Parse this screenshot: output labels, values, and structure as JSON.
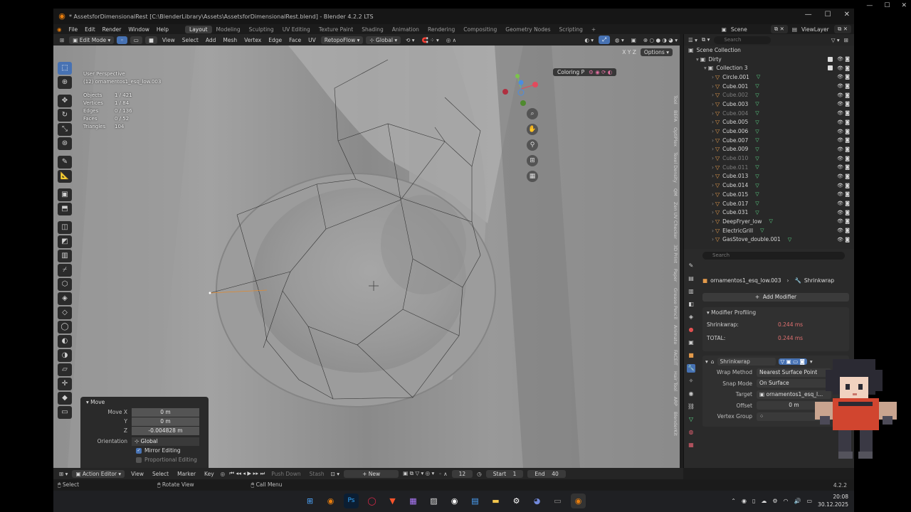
{
  "window": {
    "title": "* AssetsforDimensionalRest [C:\\BlenderLibrary\\Assets\\AssetsforDimensionalRest.blend] - Blender 4.2.2 LTS",
    "minimize": "—",
    "maximize": "☐",
    "close": "✕"
  },
  "menu": [
    "File",
    "Edit",
    "Render",
    "Window",
    "Help"
  ],
  "workspaces": [
    "Layout",
    "Modeling",
    "Sculpting",
    "UV Editing",
    "Texture Paint",
    "Shading",
    "Animation",
    "Rendering",
    "Compositing",
    "Geometry Nodes",
    "Scripting"
  ],
  "active_workspace": "Layout",
  "scene": {
    "label": "Scene",
    "viewlayer": "ViewLayer"
  },
  "viewport_header": {
    "mode": "Edit Mode",
    "menus": [
      "View",
      "Select",
      "Add",
      "Mesh",
      "Vertex",
      "Edge",
      "Face",
      "UV"
    ],
    "retopoflow": "RetopoFlow",
    "transform": "Global",
    "options": "Options",
    "axes": "X Y Z"
  },
  "overlay": {
    "view_name": "User Perspective",
    "object_name": "(12) ornamentos1_esq_low.003",
    "stats": [
      {
        "label": "Objects",
        "value": "1 / 421"
      },
      {
        "label": "Vertices",
        "value": "1 / 84"
      },
      {
        "label": "Edges",
        "value": "0 / 136"
      },
      {
        "label": "Faces",
        "value": "0 / 52"
      },
      {
        "label": "Triangles",
        "value": "104"
      }
    ],
    "coloring": "Coloring P"
  },
  "n_tabs": [
    "Tool",
    "BEFA",
    "OptiPlex",
    "Texel Density",
    "QM",
    "Zen UV Checker",
    "3D Print",
    "Paper",
    "Grease Pencil",
    "Animate",
    "FACEIT",
    "Hair Tool",
    "ARP",
    "BlenderKit"
  ],
  "move_panel": {
    "title": "Move",
    "move_x_label": "Move X",
    "move_x": "0 m",
    "y_label": "Y",
    "y": "0 m",
    "z_label": "Z",
    "z": "-0.004828 m",
    "orientation_label": "Orientation",
    "orientation": "Global",
    "mirror_editing": "Mirror Editing",
    "proportional_editing": "Proportional Editing"
  },
  "timeline": {
    "editor": "Action Editor",
    "menus": [
      "View",
      "Select",
      "Marker",
      "Key"
    ],
    "push_down": "Push Down",
    "stash": "Stash",
    "new": "New",
    "current_frame": "12",
    "start_label": "Start",
    "start": "1",
    "end_label": "End",
    "end": "40"
  },
  "statusbar": [
    "Select",
    "Rotate View",
    "Call Menu"
  ],
  "version": "4.2.2",
  "outliner": {
    "search_placeholder": "Search",
    "root": "Scene Collection",
    "items": [
      {
        "name": "Dirty",
        "kind": "collection",
        "indent": 1
      },
      {
        "name": "Collection 3",
        "kind": "collection",
        "indent": 2
      },
      {
        "name": "Circle.001",
        "kind": "object",
        "indent": 3,
        "dim": false
      },
      {
        "name": "Cube.001",
        "kind": "object",
        "indent": 3,
        "dim": false
      },
      {
        "name": "Cube.002",
        "kind": "object",
        "indent": 3,
        "dim": true
      },
      {
        "name": "Cube.003",
        "kind": "object",
        "indent": 3,
        "dim": false
      },
      {
        "name": "Cube.004",
        "kind": "object",
        "indent": 3,
        "dim": true
      },
      {
        "name": "Cube.005",
        "kind": "object",
        "indent": 3,
        "dim": false
      },
      {
        "name": "Cube.006",
        "kind": "object",
        "indent": 3,
        "dim": false
      },
      {
        "name": "Cube.007",
        "kind": "object",
        "indent": 3,
        "dim": false
      },
      {
        "name": "Cube.009",
        "kind": "object",
        "indent": 3,
        "dim": false
      },
      {
        "name": "Cube.010",
        "kind": "object",
        "indent": 3,
        "dim": true
      },
      {
        "name": "Cube.011",
        "kind": "object",
        "indent": 3,
        "dim": true
      },
      {
        "name": "Cube.013",
        "kind": "object",
        "indent": 3,
        "dim": false
      },
      {
        "name": "Cube.014",
        "kind": "object",
        "indent": 3,
        "dim": false
      },
      {
        "name": "Cube.015",
        "kind": "object",
        "indent": 3,
        "dim": false
      },
      {
        "name": "Cube.017",
        "kind": "object",
        "indent": 3,
        "dim": false
      },
      {
        "name": "Cube.031",
        "kind": "object",
        "indent": 3,
        "dim": false
      },
      {
        "name": "DeepFryer_low",
        "kind": "object",
        "indent": 3,
        "dim": false
      },
      {
        "name": "ElectricGrill",
        "kind": "object",
        "indent": 3,
        "dim": false
      },
      {
        "name": "GasStove_double.001",
        "kind": "object",
        "indent": 3,
        "dim": false
      }
    ]
  },
  "properties": {
    "search_placeholder": "Search",
    "object": "ornamentos1_esq_low.003",
    "modifier_breadcrumb": "Shrinkwrap",
    "add_modifier": "Add Modifier",
    "profiling_title": "Modifier Profiling",
    "profiling": [
      {
        "label": "Shrinkwrap:",
        "value": "0.244 ms"
      },
      {
        "label": "TOTAL:",
        "value": "0.244 ms"
      }
    ],
    "modifier_name": "Shrinkwrap",
    "fields": [
      {
        "label": "Wrap Method",
        "value": "Nearest Surface Point"
      },
      {
        "label": "Snap Mode",
        "value": "On Surface"
      },
      {
        "label": "Target",
        "value": "ornamentos1_esq_l..."
      },
      {
        "label": "Offset",
        "value": "0 m"
      },
      {
        "label": "Vertex Group",
        "value": ""
      }
    ]
  },
  "taskbar": {
    "time": "20:08",
    "date": "30.12.2025"
  },
  "colors": {
    "accent_blue": "#4772b3",
    "blender_orange": "#e87d0d",
    "profiling_red": "#e07070"
  }
}
